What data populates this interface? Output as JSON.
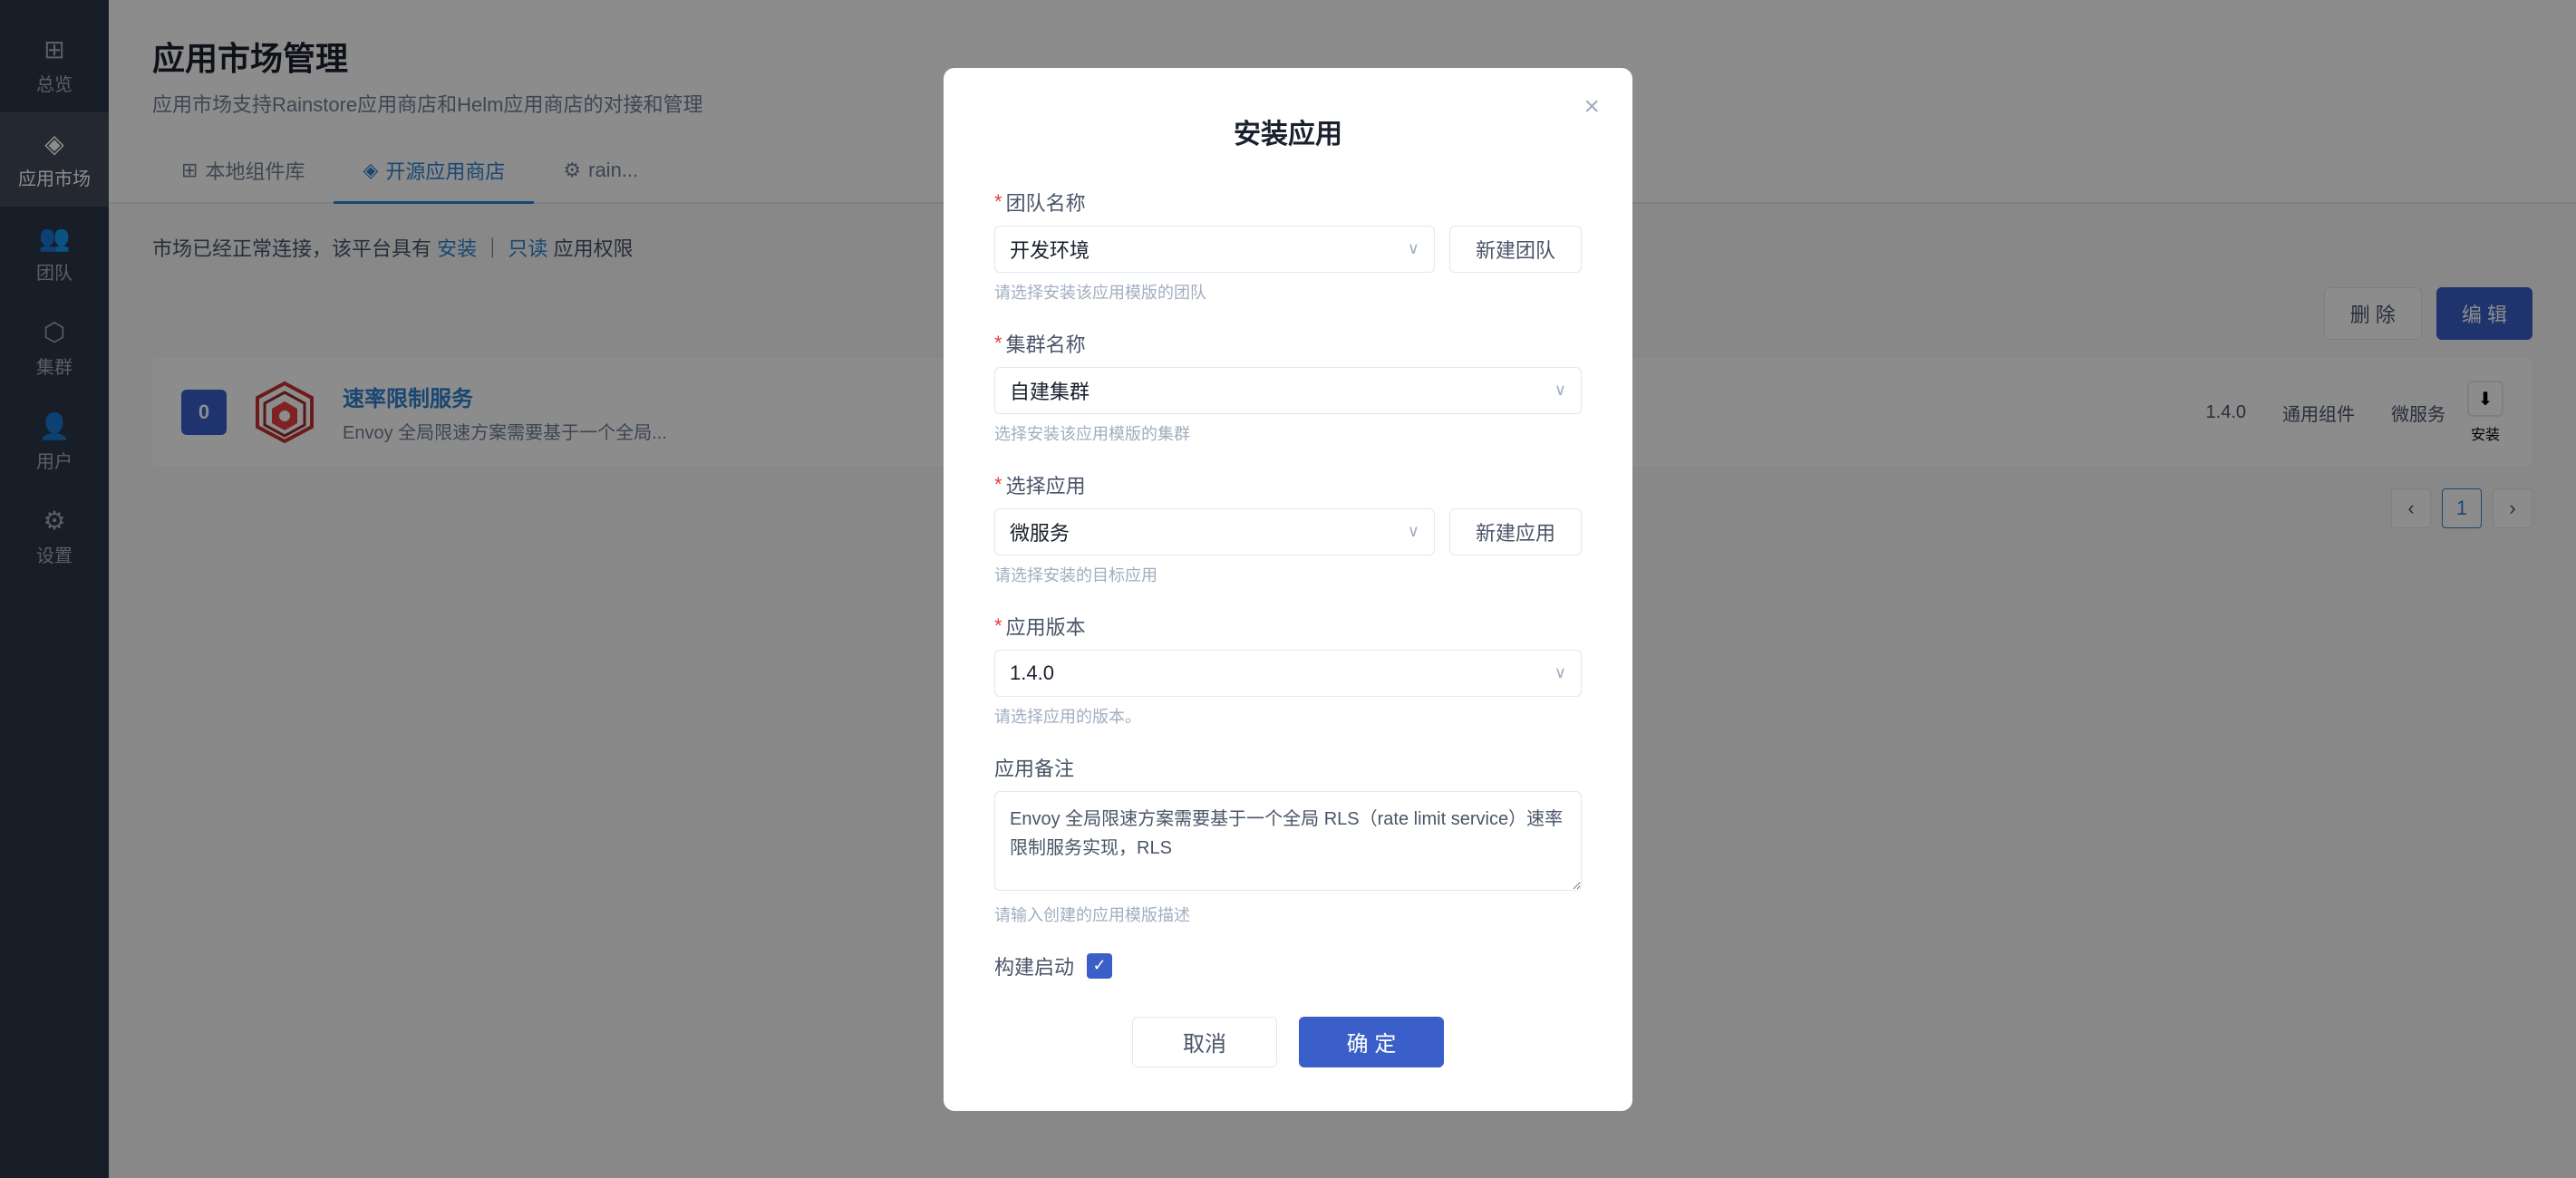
{
  "sidebar": {
    "items": [
      {
        "id": "overview",
        "label": "总览",
        "icon": "⊞",
        "active": false
      },
      {
        "id": "appmarket",
        "label": "应用市场",
        "icon": "◈",
        "active": true
      },
      {
        "id": "team",
        "label": "团队",
        "icon": "👥",
        "active": false
      },
      {
        "id": "cluster",
        "label": "集群",
        "icon": "⬡",
        "active": false
      },
      {
        "id": "user",
        "label": "用户",
        "icon": "👤",
        "active": false
      },
      {
        "id": "settings",
        "label": "设置",
        "icon": "⚙",
        "active": false
      }
    ]
  },
  "page": {
    "title": "应用市场管理",
    "description": "应用市场支持Rainstore应用商店和Helm应用商店的对接和管理"
  },
  "tabs": [
    {
      "id": "local",
      "label": "本地组件库",
      "icon": "⊞",
      "active": false
    },
    {
      "id": "opensource",
      "label": "开源应用商店",
      "icon": "◈",
      "active": true
    },
    {
      "id": "rain",
      "label": "rain...",
      "icon": "⚙",
      "active": false
    }
  ],
  "notice": {
    "prefix": "市场已经正常连接，该平台具有",
    "install_link": "安装",
    "separator": "｜",
    "readonly_link": "只读",
    "suffix": "应用权限"
  },
  "app_list_actions": {
    "delete_label": "删 除",
    "edit_label": "编 辑"
  },
  "app": {
    "badge_number": "0",
    "name": "速率限制服务",
    "description": "Envoy 全局限速方案需要基于一个全局...",
    "version": "1.4.0",
    "tag1": "通用组件",
    "tag2": "微服务",
    "install_label": "安装"
  },
  "pagination": {
    "prev": "‹",
    "current": "1",
    "next": "›"
  },
  "modal": {
    "title": "安装应用",
    "close_icon": "×",
    "fields": {
      "team_name": {
        "label": "团队名称",
        "required": true,
        "value": "开发环境",
        "hint": "请选择安装该应用模版的团队",
        "new_btn": "新建团队"
      },
      "cluster_name": {
        "label": "集群名称",
        "required": true,
        "value": "自建集群",
        "hint": "选择安装该应用模版的集群"
      },
      "select_app": {
        "label": "选择应用",
        "required": true,
        "value": "微服务",
        "hint": "请选择安装的目标应用",
        "new_btn": "新建应用"
      },
      "app_version": {
        "label": "应用版本",
        "required": true,
        "value": "1.4.0",
        "hint": "请选择应用的版本。"
      },
      "app_notes": {
        "label": "应用备注",
        "required": false,
        "value": "Envoy 全局限速方案需要基于一个全局 RLS（rate limit service）速率限制服务实现，RLS",
        "hint": "请输入创建的应用模版描述"
      },
      "build_start": {
        "label": "构建启动",
        "checked": true
      }
    },
    "cancel_label": "取消",
    "confirm_label": "确 定"
  }
}
